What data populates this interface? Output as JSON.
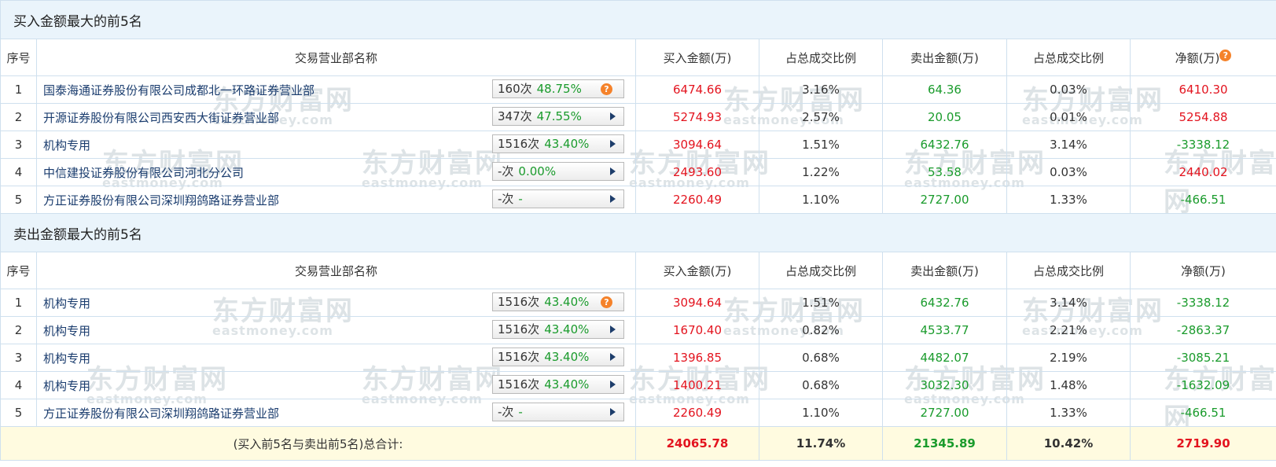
{
  "buy_section": {
    "title": "买入金额最大的前5名"
  },
  "sell_section": {
    "title": "卖出金额最大的前5名"
  },
  "headers": {
    "idx": "序号",
    "name": "交易营业部名称",
    "buy": "买入金额(万)",
    "buy_ratio": "占总成交比例",
    "sell": "卖出金额(万)",
    "sell_ratio": "占总成交比例",
    "net": "净额(万)"
  },
  "watermark": {
    "cn": "东方财富网",
    "en": "eastmoney.com"
  },
  "buy_rows": [
    {
      "idx": "1",
      "name": "国泰海通证券股份有限公司成都北一环路证券营业部",
      "count": "160次",
      "pct": "48.75%",
      "icon": "question-icon",
      "buy": "6474.66",
      "buy_ratio": "3.16%",
      "sell": "64.36",
      "sell_ratio": "0.03%",
      "net": "6410.30",
      "net_color": "red"
    },
    {
      "idx": "2",
      "name": "开源证券股份有限公司西安西大街证券营业部",
      "count": "347次",
      "pct": "47.55%",
      "icon": "play-arrow-icon",
      "buy": "5274.93",
      "buy_ratio": "2.57%",
      "sell": "20.05",
      "sell_ratio": "0.01%",
      "net": "5254.88",
      "net_color": "red"
    },
    {
      "idx": "3",
      "name": "机构专用",
      "count": "1516次",
      "pct": "43.40%",
      "icon": "play-arrow-icon",
      "buy": "3094.64",
      "buy_ratio": "1.51%",
      "sell": "6432.76",
      "sell_ratio": "3.14%",
      "net": "-3338.12",
      "net_color": "green"
    },
    {
      "idx": "4",
      "name": "中信建投证券股份有限公司河北分公司",
      "count": "-次",
      "pct": "0.00%",
      "icon": "play-arrow-icon",
      "buy": "2493.60",
      "buy_ratio": "1.22%",
      "sell": "53.58",
      "sell_ratio": "0.03%",
      "net": "2440.02",
      "net_color": "red"
    },
    {
      "idx": "5",
      "name": "方正证券股份有限公司深圳翔鸽路证券营业部",
      "count": "-次",
      "pct": "-",
      "icon": "play-arrow-icon",
      "buy": "2260.49",
      "buy_ratio": "1.10%",
      "sell": "2727.00",
      "sell_ratio": "1.33%",
      "net": "-466.51",
      "net_color": "green"
    }
  ],
  "sell_rows": [
    {
      "idx": "1",
      "name": "机构专用",
      "count": "1516次",
      "pct": "43.40%",
      "icon": "question-icon",
      "buy": "3094.64",
      "buy_ratio": "1.51%",
      "sell": "6432.76",
      "sell_ratio": "3.14%",
      "net": "-3338.12",
      "net_color": "green"
    },
    {
      "idx": "2",
      "name": "机构专用",
      "count": "1516次",
      "pct": "43.40%",
      "icon": "play-arrow-icon",
      "buy": "1670.40",
      "buy_ratio": "0.82%",
      "sell": "4533.77",
      "sell_ratio": "2.21%",
      "net": "-2863.37",
      "net_color": "green"
    },
    {
      "idx": "3",
      "name": "机构专用",
      "count": "1516次",
      "pct": "43.40%",
      "icon": "play-arrow-icon",
      "buy": "1396.85",
      "buy_ratio": "0.68%",
      "sell": "4482.07",
      "sell_ratio": "2.19%",
      "net": "-3085.21",
      "net_color": "green"
    },
    {
      "idx": "4",
      "name": "机构专用",
      "count": "1516次",
      "pct": "43.40%",
      "icon": "play-arrow-icon",
      "buy": "1400.21",
      "buy_ratio": "0.68%",
      "sell": "3032.30",
      "sell_ratio": "1.48%",
      "net": "-1632.09",
      "net_color": "green"
    },
    {
      "idx": "5",
      "name": "方正证券股份有限公司深圳翔鸽路证券营业部",
      "count": "-次",
      "pct": "-",
      "icon": "play-arrow-icon",
      "buy": "2260.49",
      "buy_ratio": "1.10%",
      "sell": "2727.00",
      "sell_ratio": "1.33%",
      "net": "-466.51",
      "net_color": "green"
    }
  ],
  "totals": {
    "label": "(买入前5名与卖出前5名)总合计:",
    "buy": "24065.78",
    "buy_ratio": "11.74%",
    "sell": "21345.89",
    "sell_ratio": "10.42%",
    "net": "2719.90"
  }
}
